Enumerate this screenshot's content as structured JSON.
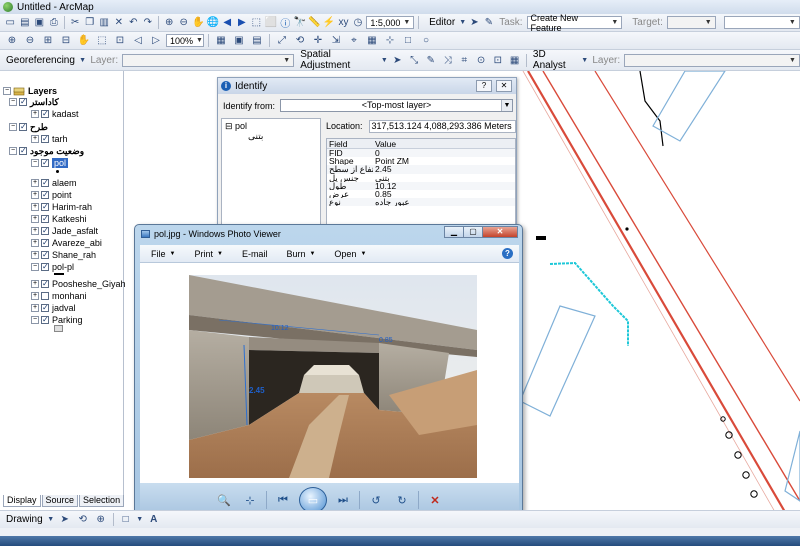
{
  "window": {
    "title": "Untitled - ArcMap"
  },
  "toolbar1": {
    "zoom": "1:5,000",
    "editor": "Editor",
    "task_label": "Task:",
    "task_value": "Create New Feature",
    "target_label": "Target:"
  },
  "toolbar2": {
    "zoom_percent": "100%"
  },
  "toolbar3": {
    "georeferencing": "Georeferencing",
    "layer_label": "Layer:",
    "spatial_adjustment": "Spatial Adjustment",
    "analyst": "3D Analyst",
    "analyst_layer_label": "Layer:"
  },
  "toc": {
    "root": "Layers",
    "groups": [
      {
        "name": "کاداستر",
        "children": [
          "kadast"
        ]
      },
      {
        "name": "طرح",
        "children": [
          "tarh"
        ]
      },
      {
        "name": "وضعیت موجود",
        "children": [
          "pol"
        ]
      }
    ],
    "layers": [
      "alaem",
      "point",
      "Harim-rah",
      "Katkeshi",
      "Jade_asfalt",
      "Avareze_abi",
      "Shane_rah",
      "pol-pl",
      "Poosheshe_Giyahi",
      "monhani",
      "jadval",
      "Parking"
    ],
    "selected": "pol",
    "tabs": [
      "Display",
      "Source",
      "Selection"
    ]
  },
  "identify": {
    "title": "Identify",
    "from_label": "Identify from:",
    "from_value": "<Top-most layer>",
    "tree_root": "pol",
    "tree_child": "بتنی",
    "location_label": "Location:",
    "location_value": "317,513.124  4,088,293.386 Meters",
    "field_header": "Field",
    "value_header": "Value",
    "rows": [
      {
        "field": "FID",
        "value": "0"
      },
      {
        "field": "Shape",
        "value": "Point ZM"
      },
      {
        "field": "ارتفاع از سطح",
        "value": "2.45"
      },
      {
        "field": "جنس پل",
        "value": "بتنی"
      },
      {
        "field": "طول",
        "value": "10.12"
      },
      {
        "field": "عرض",
        "value": "0.85"
      },
      {
        "field": "نوع",
        "value": "عبور جاده"
      }
    ]
  },
  "photo_viewer": {
    "title": "pol.jpg - Windows Photo Viewer",
    "menu": [
      "File",
      "Print",
      "E-mail",
      "Burn",
      "Open"
    ],
    "photo_labels": {
      "height": "2.45",
      "length": "10.12",
      "width": "0.85"
    }
  },
  "drawbar": {
    "drawing": "Drawing"
  },
  "colors": {
    "road_red": "#d94a3a",
    "road_blue": "#7fb0d8",
    "cyan_line": "#1ec8d8",
    "selection": "#316ac5"
  }
}
